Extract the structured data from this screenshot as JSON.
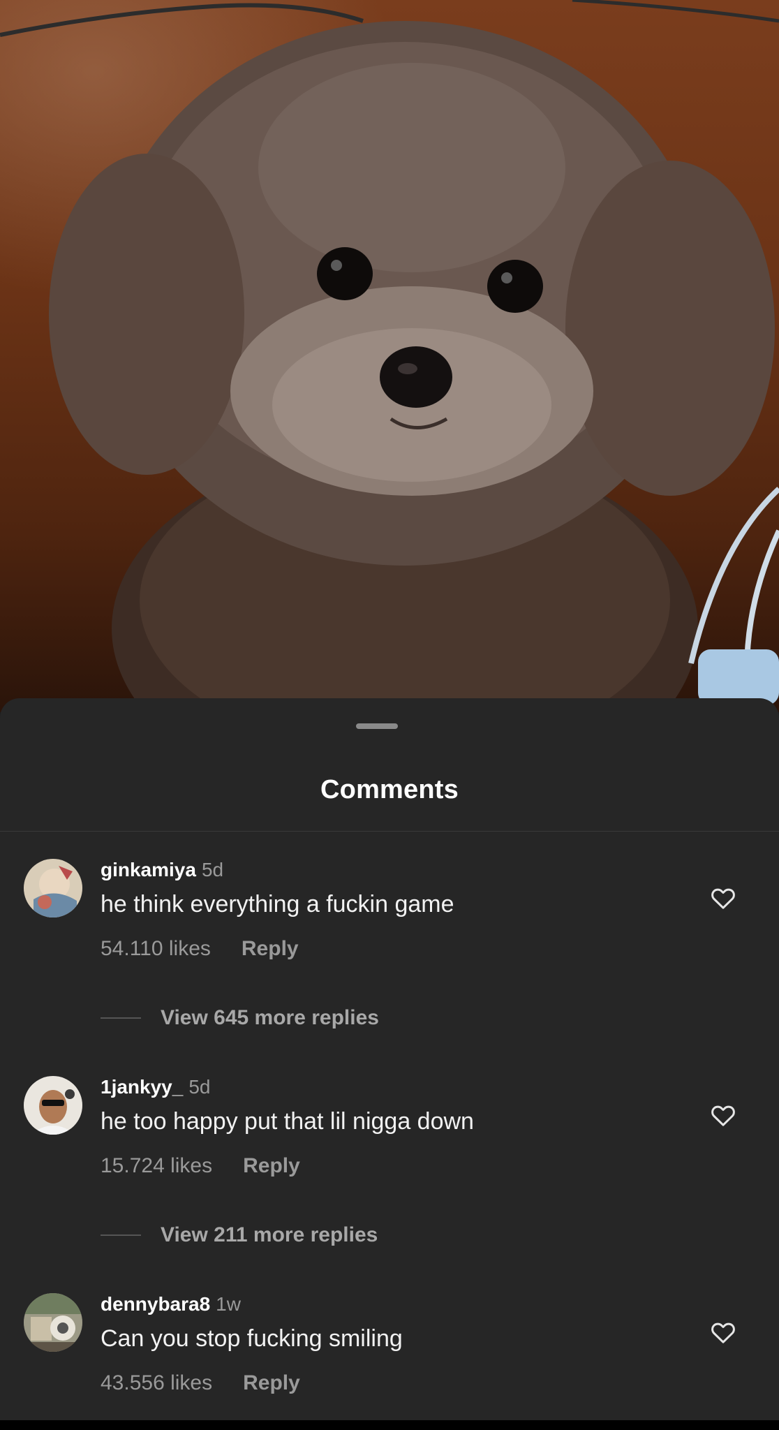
{
  "sheet": {
    "title": "Comments"
  },
  "comments": [
    {
      "username": "ginkamiya",
      "time": "5d",
      "text": "he think everything a fuckin game",
      "likes": "54.110 likes",
      "reply_label": "Reply",
      "view_replies": "View 645 more replies"
    },
    {
      "username": "1jankyy_",
      "time": "5d",
      "text": "he too happy put that lil nigga down",
      "likes": "15.724 likes",
      "reply_label": "Reply",
      "view_replies": "View 211 more replies"
    },
    {
      "username": "dennybara8",
      "time": "1w",
      "text": "Can you stop fucking smiling",
      "likes": "43.556 likes",
      "reply_label": "Reply"
    }
  ],
  "icons": {
    "like": "heart-outline-icon"
  },
  "colors": {
    "sheet_background": "#262626",
    "primary_text": "#ffffff",
    "secondary_text": "#9a9a9a"
  }
}
